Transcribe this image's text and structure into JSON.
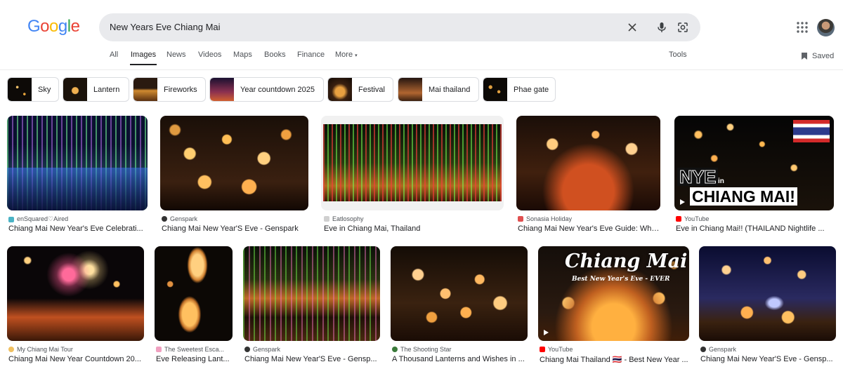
{
  "search": {
    "query": "New Years Eve Chiang Mai"
  },
  "logo": {
    "text": [
      "G",
      "o",
      "o",
      "g",
      "l",
      "e"
    ],
    "colors": [
      "#4285F4",
      "#EA4335",
      "#FBBC05",
      "#4285F4",
      "#34A853",
      "#EA4335"
    ]
  },
  "tabs": [
    "All",
    "Images",
    "News",
    "Videos",
    "Maps",
    "Books",
    "Finance",
    "More"
  ],
  "tools_label": "Tools",
  "saved_label": "Saved",
  "chips": [
    "Sky",
    "Lantern",
    "Fireworks",
    "Year countdown 2025",
    "Festival",
    "Mai thailand",
    "Phae gate"
  ],
  "results": [
    {
      "source": "enSquared♡Aired",
      "title": "Chiang Mai New Year's Eve Celebrati..."
    },
    {
      "source": "Genspark",
      "title": "Chiang Mai New Year'S Eve - Genspark"
    },
    {
      "source": "Eatlosophy",
      "title": "Eve in Chiang Mai, Thailand"
    },
    {
      "source": "Sonasia Holiday",
      "title": "Chiang Mai New Year's Eve Guide: Wha..."
    },
    {
      "source": "YouTube",
      "title": "Eve in Chiang Mai!! (THAILAND Nightlife ..."
    },
    {
      "source": "My Chiang Mai Tour",
      "title": "Chiang Mai New Year Countdown 20..."
    },
    {
      "source": "The Sweetest Esca...",
      "title": "Eve Releasing Lant..."
    },
    {
      "source": "Genspark",
      "title": "Chiang Mai New Year'S Eve - Gensp..."
    },
    {
      "source": "The Shooting Star",
      "title": "A Thousand Lanterns and Wishes in ..."
    },
    {
      "source": "YouTube",
      "title": "Chiang Mai Thailand 🇹🇭 - Best New Year ..."
    },
    {
      "source": "Genspark",
      "title": "Chiang Mai New Year'S Eve - Gensp..."
    }
  ],
  "overlays": {
    "nye": "NYE",
    "in": "in",
    "chiang_mai_caps": "CHIANG MAI!",
    "chiang_mai_script": "Chiang Mai",
    "best_nye": "Best New Year's Eve - EVER"
  }
}
